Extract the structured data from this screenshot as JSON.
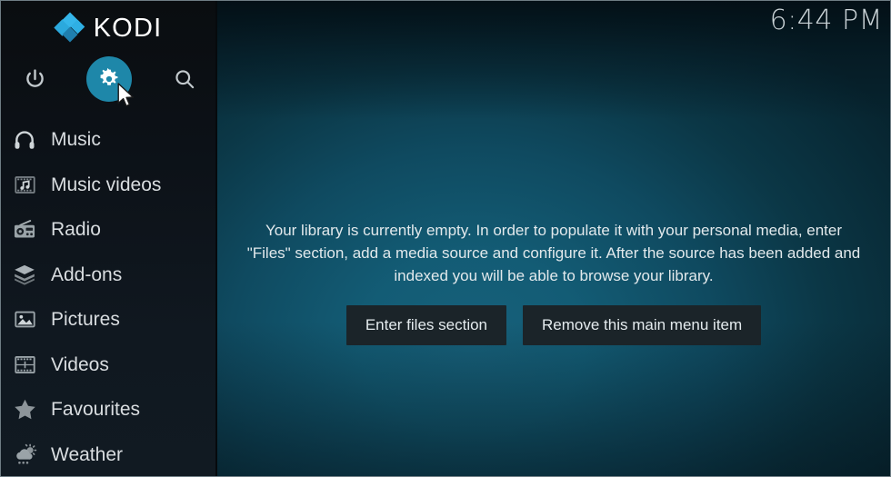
{
  "app": {
    "name": "KODI",
    "logo_color": "#29abe2"
  },
  "header": {
    "clock": "6:44 PM",
    "toolbar": [
      {
        "name": "power",
        "label": "Power",
        "active": false
      },
      {
        "name": "settings",
        "label": "Settings",
        "active": true,
        "highlight_color": "#1e87a9"
      },
      {
        "name": "search",
        "label": "Search",
        "active": false
      }
    ]
  },
  "sidebar": {
    "items": [
      {
        "label": "Music",
        "icon": "headphones-icon"
      },
      {
        "label": "Music videos",
        "icon": "film-music-icon"
      },
      {
        "label": "Radio",
        "icon": "radio-icon"
      },
      {
        "label": "Add-ons",
        "icon": "layers-box-icon"
      },
      {
        "label": "Pictures",
        "icon": "picture-icon"
      },
      {
        "label": "Videos",
        "icon": "film-strip-icon"
      },
      {
        "label": "Favourites",
        "icon": "star-icon"
      },
      {
        "label": "Weather",
        "icon": "cloud-sun-rain-icon"
      }
    ]
  },
  "main": {
    "empty_message": "Your library is currently empty. In order to populate it with your personal media, enter \"Files\" section, add a media source and configure it. After the source has been added and indexed you will be able to browse your library.",
    "buttons": {
      "enter_files": "Enter files section",
      "remove_item": "Remove this main menu item"
    }
  },
  "theme": {
    "sidebar_bg": "#101820",
    "content_accent": "#135c75",
    "button_bg": "#1b2429",
    "text_primary": "#e2e9ec",
    "text_menu": "#d9dde0"
  }
}
